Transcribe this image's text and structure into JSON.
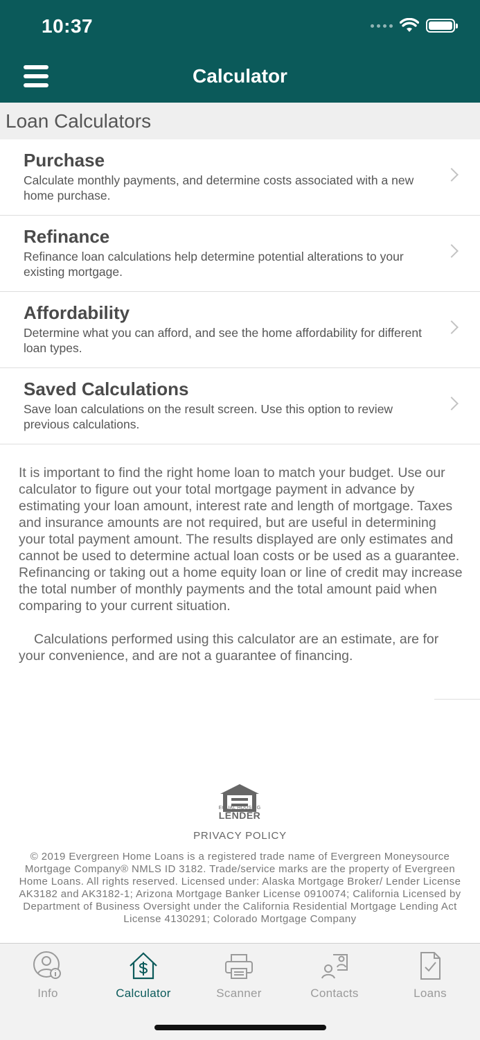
{
  "status_bar": {
    "time": "10:37"
  },
  "header": {
    "title": "Calculator"
  },
  "section": {
    "title": "Loan Calculators"
  },
  "calculators": [
    {
      "title": "Purchase",
      "description": "Calculate monthly payments, and determine costs associated with a new home purchase."
    },
    {
      "title": "Refinance",
      "description": "Refinance loan calculations help determine potential alterations to your existing mortgage."
    },
    {
      "title": "Affordability",
      "description": "Determine what you can afford, and see the home affordability for different loan types."
    },
    {
      "title": "Saved Calculations",
      "description": "Save loan calculations on the result screen. Use this option to review previous calculations."
    }
  ],
  "disclaimer": {
    "paragraph1": "It is important to find the right home loan to match your budget. Use our calculator to figure out your total mortgage payment in advance by estimating your loan amount, interest rate and length of mortgage. Taxes and insurance amounts are not required, but are useful in determining your total payment amount. The results displayed are only estimates and cannot be used to determine actual loan costs or be used as a guarantee. Refinancing or taking out a home equity loan or line of credit may increase the total number of monthly payments and the total amount paid when comparing to your current situation.",
    "paragraph2": "Calculations performed using this calculator are an estimate, are for your convenience, and are not a guarantee of financing."
  },
  "footer": {
    "ehl_tagline": "EQUAL HOUSING",
    "ehl_word": "LENDER",
    "privacy_policy": "PRIVACY POLICY",
    "legal": "© 2019 Evergreen Home Loans is a registered trade name of Evergreen Moneysource Mortgage Company® NMLS ID 3182. Trade/service marks are the property of Evergreen Home Loans. All rights reserved. Licensed under: Alaska Mortgage Broker/ Lender License AK3182 and AK3182-1; Arizona Mortgage Banker License 0910074; California Licensed by Department of Business Oversight under the California Residential Mortgage Lending Act License 4130291; Colorado Mortgage Company"
  },
  "tabs": [
    {
      "label": "Info",
      "icon": "user-info-icon",
      "active": false
    },
    {
      "label": "Calculator",
      "icon": "home-dollar-icon",
      "active": true
    },
    {
      "label": "Scanner",
      "icon": "printer-icon",
      "active": false
    },
    {
      "label": "Contacts",
      "icon": "contacts-icon",
      "active": false
    },
    {
      "label": "Loans",
      "icon": "document-check-icon",
      "active": false
    }
  ],
  "colors": {
    "brand": "#0b5a5a",
    "tab_inactive": "#9a9a9a"
  }
}
